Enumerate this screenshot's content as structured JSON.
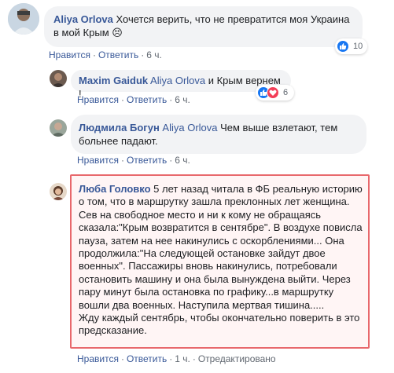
{
  "comments": [
    {
      "author": "Aliya Orlova",
      "text": "Хочется верить, что не превратится моя Украина в мой Крым ",
      "emoji": "😣",
      "actions": {
        "like": "Нравится",
        "reply": "Ответить",
        "time": "6 ч."
      },
      "reactions": {
        "count": "10"
      }
    },
    {
      "author": "Maxim Gaiduk",
      "mention": "Aliya Orlova",
      "text": " и Крым вернем !",
      "actions": {
        "like": "Нравится",
        "reply": "Ответить",
        "time": "6 ч."
      },
      "reactions": {
        "count": "6"
      }
    },
    {
      "author": "Людмила Богун",
      "mention": "Aliya Orlova",
      "text": " Чем выше взлетают, тем больнее падают.",
      "actions": {
        "like": "Нравится",
        "reply": "Ответить",
        "time": "6 ч."
      }
    },
    {
      "author": "Люба Головко",
      "text": " 5 лет назад читала в ФБ реальную историю о том, что в маршрутку зашла преклонных лет женщина. Сев на свободное место и ни к кому не обращаясь сказала:\"Крым возвратится в сентябре\". В воздухе повисла пауза, затем на нее накинулись с оскорблениями... Она продолжила:\"На следующей остановке зайдут двое военных\". Пассажиры вновь накинулись, потребовали остановить машину и она была вынуждена выйти. Через пару минут была остановка по графику...в маршрутку вошли два военных. Наступила мертвая тишина.....",
      "text2": "Жду каждый сентябрь, чтобы окончательно поверить в это предсказание.",
      "actions": {
        "like": "Нравится",
        "reply": "Ответить",
        "time": "1 ч.",
        "edited": "Отредактировано"
      }
    }
  ],
  "colors": {
    "link": "#385898",
    "bubble": "#f2f3f5",
    "meta": "#606770",
    "highlight_border": "#e8686c",
    "like_blue": "#1877f2",
    "love_red": "#f33e58"
  }
}
